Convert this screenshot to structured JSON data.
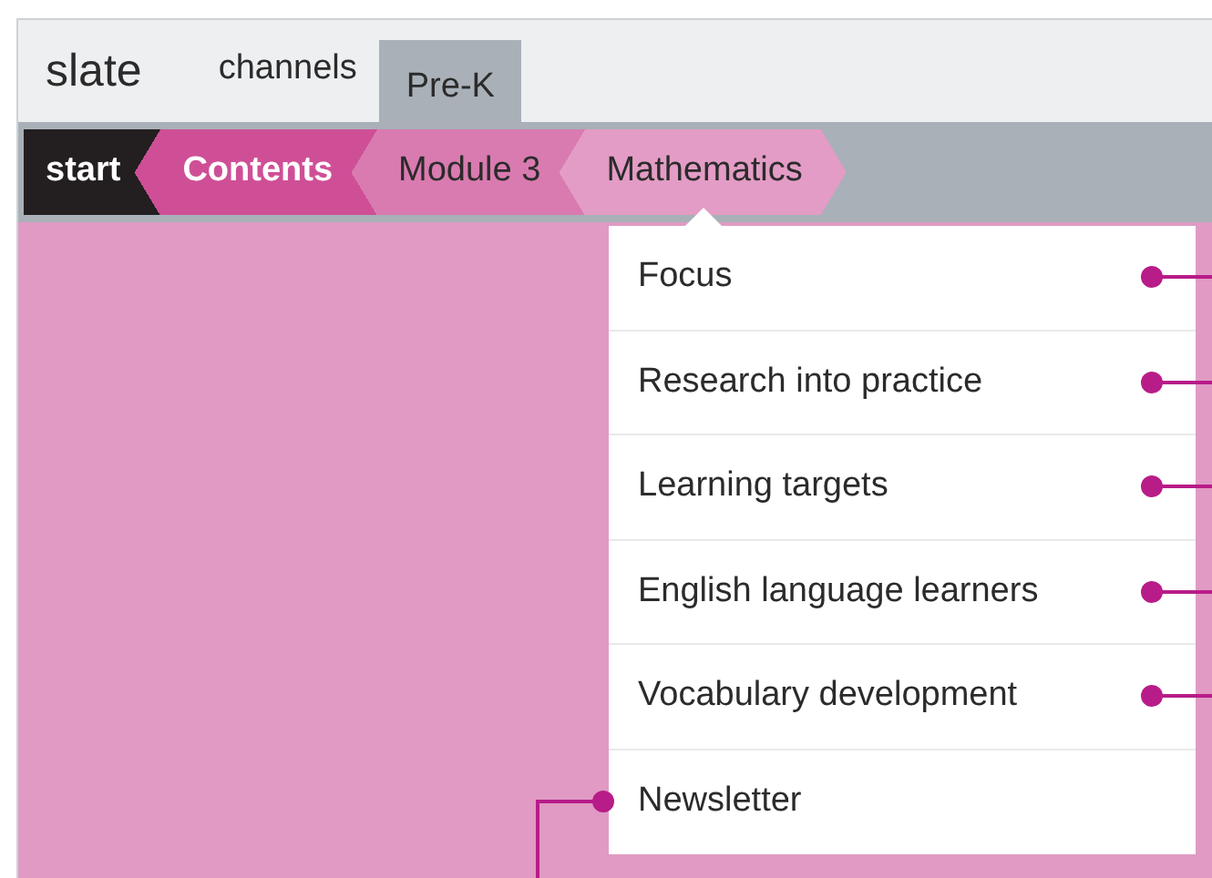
{
  "header": {
    "logo": "slate",
    "tabs": [
      {
        "label": "channels",
        "selected": false
      },
      {
        "label": "Pre-K",
        "selected": true
      }
    ]
  },
  "breadcrumb": [
    {
      "label": "start",
      "color": "#231f20",
      "bold": true
    },
    {
      "label": "Contents",
      "color": "#cf4f97",
      "bold": true
    },
    {
      "label": "Module 3",
      "color": "#d97bb0",
      "bold": false
    },
    {
      "label": "Mathematics",
      "color": "#e39cc5",
      "bold": false
    }
  ],
  "menu": {
    "items": [
      {
        "label": "Focus",
        "kind": "right"
      },
      {
        "label": "Research into practice",
        "kind": "right"
      },
      {
        "label": "Learning targets",
        "kind": "right"
      },
      {
        "label": "English language learners",
        "kind": "right"
      },
      {
        "label": "Vocabulary development",
        "kind": "right"
      },
      {
        "label": "Newsletter",
        "kind": "left"
      }
    ]
  }
}
